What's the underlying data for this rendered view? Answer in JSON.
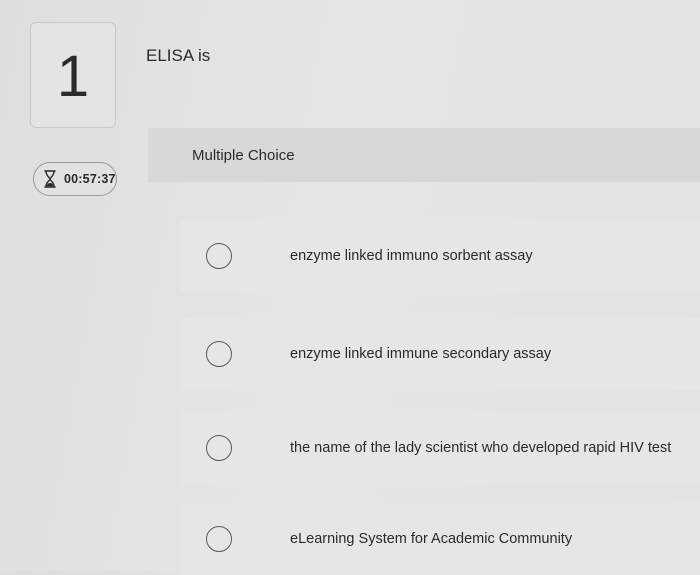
{
  "question": {
    "number": "1",
    "text": "ELISA is",
    "type_label": "Multiple Choice"
  },
  "timer": {
    "icon": "hourglass-icon",
    "value": "00:57:37"
  },
  "options": [
    {
      "label": "enzyme linked immuno sorbent assay",
      "selected": false
    },
    {
      "label": "enzyme linked immune secondary assay",
      "selected": false
    },
    {
      "label": "the name of the lady scientist who developed rapid HIV test",
      "selected": false
    },
    {
      "label": "eLearning System for Academic Community",
      "selected": false
    }
  ],
  "colors": {
    "background": "#e3e3e3",
    "header_band": "#d8d8d8",
    "text": "#2a2a2a",
    "radio_border": "#5a5a5a"
  }
}
